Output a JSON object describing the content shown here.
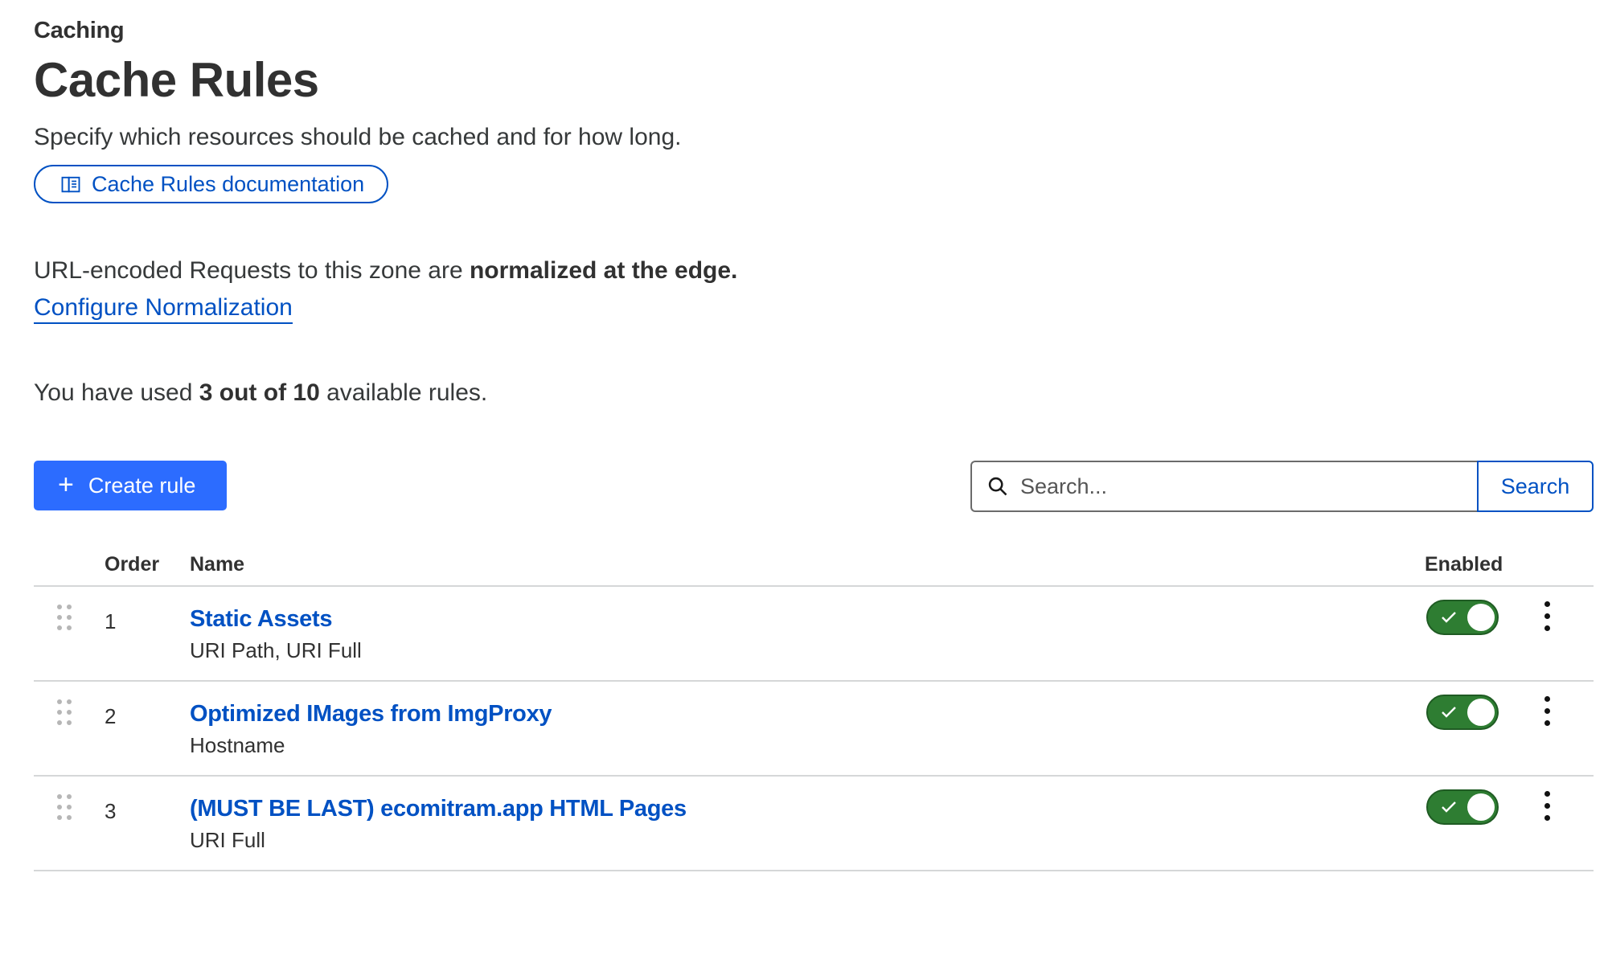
{
  "header": {
    "eyebrow": "Caching",
    "title": "Cache Rules",
    "subtitle": "Specify which resources should be cached and for how long.",
    "doc_button": "Cache Rules documentation"
  },
  "normalization": {
    "text_prefix": "URL-encoded Requests to this zone are ",
    "text_bold": "normalized at the edge.",
    "link": "Configure Normalization"
  },
  "usage": {
    "prefix": "You have used ",
    "bold": "3 out of 10",
    "suffix": " available rules."
  },
  "toolbar": {
    "create_label": "Create rule",
    "search_placeholder": "Search...",
    "search_button": "Search"
  },
  "table": {
    "headers": {
      "order": "Order",
      "name": "Name",
      "enabled": "Enabled"
    },
    "rows": [
      {
        "order": "1",
        "name": "Static Assets",
        "fields": "URI Path, URI Full",
        "enabled": true
      },
      {
        "order": "2",
        "name": "Optimized IMages from ImgProxy",
        "fields": "Hostname",
        "enabled": true
      },
      {
        "order": "3",
        "name": "(MUST BE LAST) ecomitram.app HTML Pages",
        "fields": "URI Full",
        "enabled": true
      }
    ]
  },
  "colors": {
    "link_blue": "#0051c3",
    "primary_button": "#2c6cff",
    "toggle_on": "#2e7d32"
  },
  "icons": [
    "book-icon",
    "plus-icon",
    "search-icon",
    "drag-handle-icon",
    "check-icon",
    "kebab-menu-icon"
  ]
}
